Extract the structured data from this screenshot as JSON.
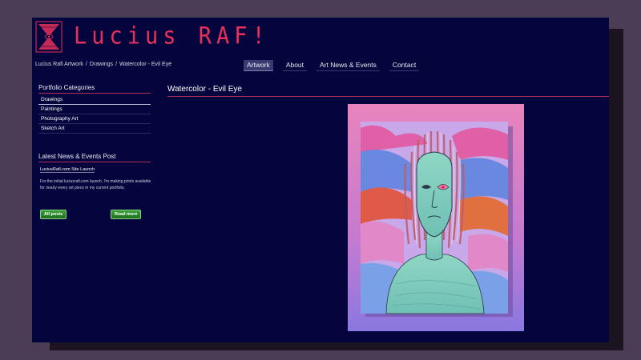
{
  "site": {
    "logo_text": "Lucius RAF!",
    "logo_icon": "hourglass-eye-logo-icon",
    "colors": {
      "background": "#4a3d55",
      "panel": "#05053d",
      "accent": "#e8305a",
      "button": "#2a8a2a"
    }
  },
  "breadcrumb": [
    "Lucius Rafi Artwork",
    "Drawings",
    "Watercolor - Evil Eye"
  ],
  "breadcrumb_sep": "/",
  "nav": {
    "items": [
      "Artwork",
      "About",
      "Art News & Events",
      "Contact"
    ],
    "active": "Artwork"
  },
  "sidebar": {
    "categories_title": "Portfolio Categories",
    "categories": [
      "Drawings",
      "Paintings",
      "Photography Art",
      "Sketch Art"
    ],
    "active_category": "Drawings",
    "news_title": "Latest News & Events Post",
    "news_link": "LuciusRafi.com Site Launch",
    "news_body": "For the initial luciusrafi.com launch, I'm making prints available for nearly every art piece in my current portfolio.",
    "all_posts_label": "All posts",
    "read_more_label": "Read more"
  },
  "content": {
    "title": "Watercolor - Evil Eye",
    "image_icon": "artwork-image"
  }
}
